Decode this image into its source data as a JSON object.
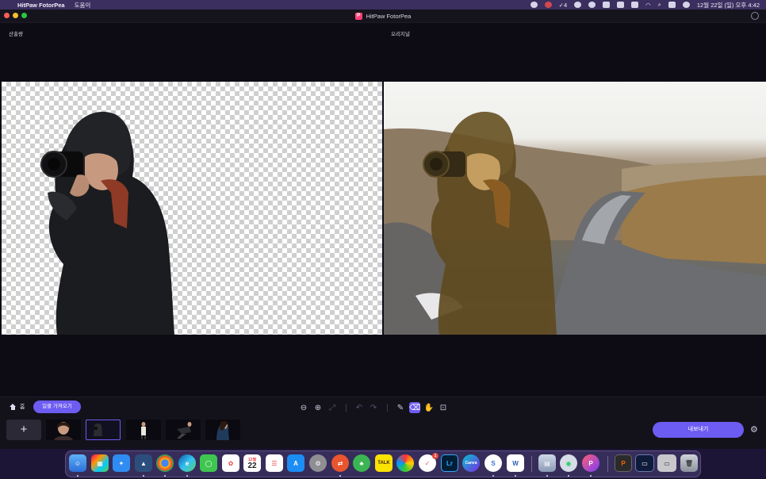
{
  "menubar": {
    "app_name": "HitPaw FotorPea",
    "menu_help": "도움이",
    "badge_count": "4",
    "datetime": "12월 22일 (일) 오후 4:42"
  },
  "window": {
    "title": "HitPaw FotorPea",
    "logo_letter": "P"
  },
  "canvas": {
    "output_label": "산출량",
    "original_label": "오리지널"
  },
  "toolbar": {
    "home_label": "홈",
    "import_label": "일괄 가져오기",
    "export_label": "내보내기",
    "tools": [
      {
        "name": "zoom-out-icon",
        "glyph": "⊖",
        "enabled": true
      },
      {
        "name": "zoom-in-icon",
        "glyph": "⊕",
        "enabled": true
      },
      {
        "name": "fit-screen-icon",
        "glyph": "⤢",
        "enabled": false
      },
      {
        "name": "undo-icon",
        "glyph": "↶",
        "enabled": false
      },
      {
        "name": "redo-icon",
        "glyph": "↷",
        "enabled": false
      },
      {
        "name": "brush-icon",
        "glyph": "✎",
        "enabled": true
      },
      {
        "name": "eraser-icon",
        "glyph": "⌫",
        "enabled": true,
        "active": true
      },
      {
        "name": "hand-icon",
        "glyph": "✋",
        "enabled": true
      },
      {
        "name": "compare-icon",
        "glyph": "⊡",
        "enabled": true
      }
    ]
  },
  "thumbnails": {
    "add_label": "+",
    "count": 5,
    "selected_index": 1
  },
  "dock": {
    "calendar_month": "12월",
    "calendar_day": "22",
    "kakao_label": "TALK",
    "lightroom_label": "Lr",
    "canva_label": "Canva",
    "word_label": "W",
    "badge_count": "1"
  },
  "colors": {
    "accent": "#6d5cf2",
    "background": "#0d0c15",
    "menubar": "#3a2f5e"
  }
}
